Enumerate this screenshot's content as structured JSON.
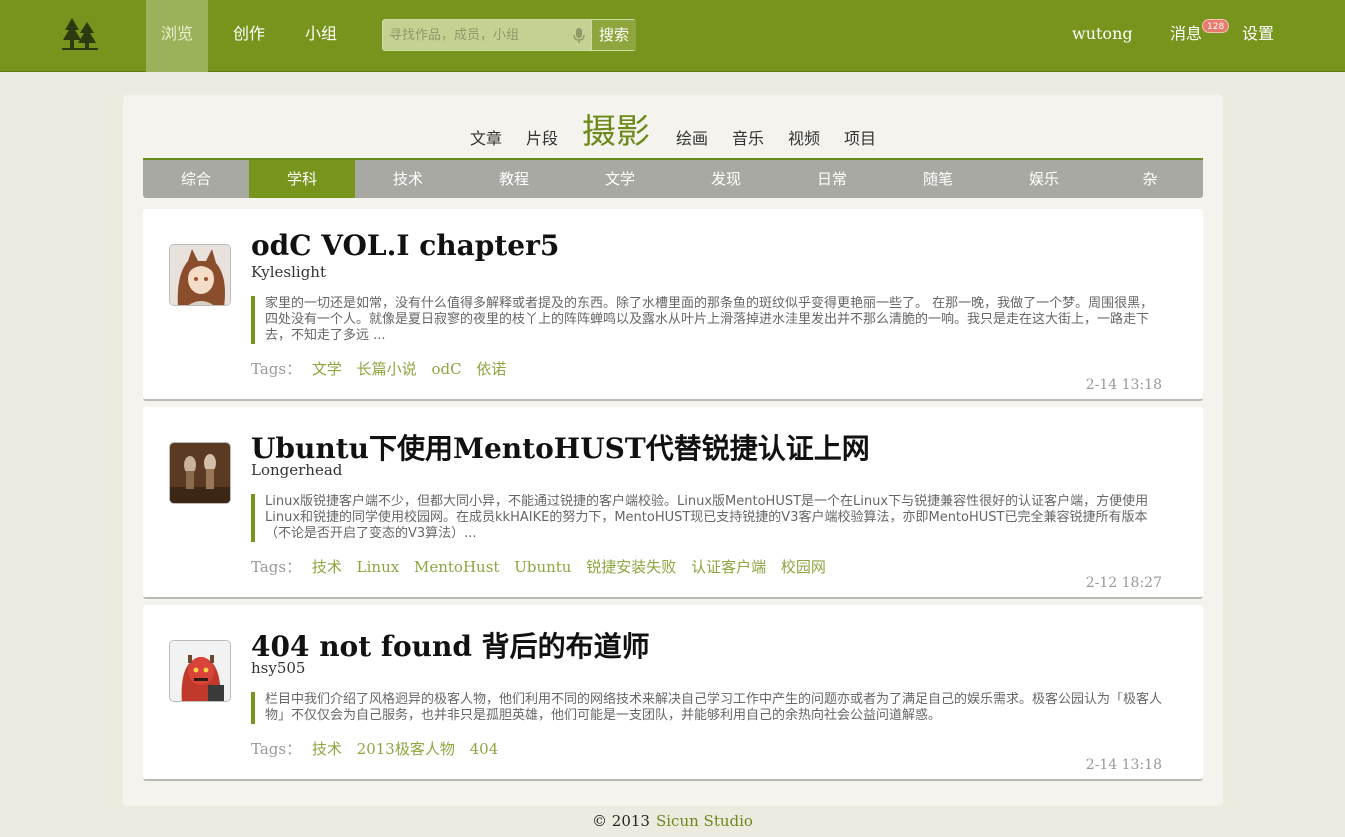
{
  "nav": {
    "items": [
      "浏览",
      "创作",
      "小组"
    ],
    "active_index": 0,
    "search_placeholder": "寻找作品，成员，小组",
    "search_button": "搜索",
    "username": "wutong",
    "messages_label": "消息",
    "messages_count": "128",
    "settings_label": "设置"
  },
  "categories": {
    "items": [
      "文章",
      "片段",
      "摄影",
      "绘画",
      "音乐",
      "视频",
      "项目"
    ],
    "current": "摄影"
  },
  "subnav": {
    "items": [
      "综合",
      "学科",
      "技术",
      "教程",
      "文学",
      "发现",
      "日常",
      "随笔",
      "娱乐",
      "杂"
    ],
    "active": "学科"
  },
  "posts": [
    {
      "title": "odC VOL.I chapter5",
      "author": "Kyleslight",
      "excerpt": "家里的一切还是如常，没有什么值得多解释或者提及的东西。除了水槽里面的那条鱼的斑纹似乎变得更艳丽一些了。 在那一晚，我做了一个梦。周围很黑，四处没有一个人。就像是夏日寂寥的夜里的枝丫上的阵阵蝉鸣以及露水从叶片上滑落掉进水洼里发出并不那么清脆的一响。我只是走在这大街上，一路走下去，不知走了多远 ...",
      "tags_label": "Tags：",
      "tags": [
        "文学",
        "长篇小说",
        "odC",
        "依诺"
      ],
      "date": "2-14 13:18",
      "avatar": "fox-girl-avatar"
    },
    {
      "title": "Ubuntu下使用MentoHUST代替锐捷认证上网",
      "author": "Longerhead",
      "excerpt": "Linux版锐捷客户端不少，但都大同小异，不能通过锐捷的客户端校验。Linux版MentoHUST是一个在Linux下与锐捷兼容性很好的认证客户端，方便使用Linux和锐捷的同学使用校园网。在成员kkHAIKE的努力下，MentoHUST现已支持锐捷的V3客户端校验算法，亦即MentoHUST已完全兼容锐捷所有版本（不论是否开启了变态的V3算法）...",
      "tags_label": "Tags：",
      "tags": [
        "技术",
        "Linux",
        "MentoHust",
        "Ubuntu",
        "锐捷安装失败",
        "认证客户端",
        "校园网"
      ],
      "date": "2-12 18:27",
      "avatar": "brown-figures-avatar"
    },
    {
      "title": "404 not found 背后的布道师",
      "author": "hsy505",
      "excerpt": "栏目中我们介绍了风格迥异的极客人物，他们利用不同的网络技术来解决自己学习工作中产生的问题亦或者为了满足自己的娱乐需求。极客公园认为「极客人物」不仅仅会为自己服务，也并非只是孤胆英雄，他们可能是一支团队，并能够利用自己的余热向社会公益问道解惑。",
      "tags_label": "Tags：",
      "tags": [
        "技术",
        "2013极客人物",
        "404"
      ],
      "date": "2-14 13:18",
      "avatar": "red-hero-avatar"
    }
  ],
  "footer": {
    "copyright": "© 2013",
    "studio": "Sicun Studio"
  },
  "colors": {
    "brand_green": "#77951c",
    "tag_green": "#8ca640",
    "badge_red": "#e77b6c"
  }
}
